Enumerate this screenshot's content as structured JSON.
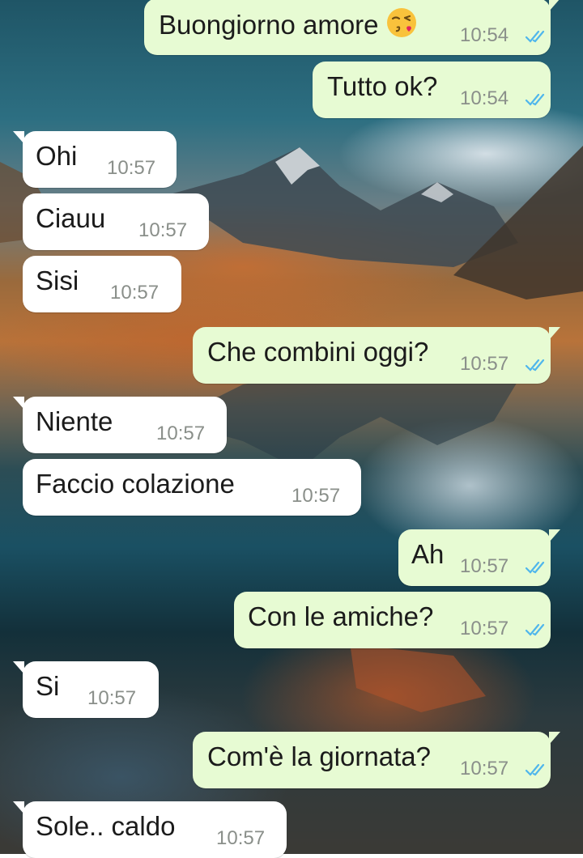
{
  "colors": {
    "outgoing_bubble": "#e7fbd3",
    "incoming_bubble": "#ffffff",
    "read_ticks": "#4fb6ec"
  },
  "icons": {
    "read_receipt": "double-check-icon",
    "emoji": "face-blowing-kiss-emoji"
  },
  "messages": [
    {
      "direction": "outgoing",
      "text": "Buongiorno amore",
      "time": "10:54",
      "status": "read"
    },
    {
      "direction": "outgoing",
      "text": "Tutto ok?",
      "time": "10:54",
      "status": "read"
    },
    {
      "direction": "incoming",
      "text": "Ohi",
      "time": "10:57"
    },
    {
      "direction": "incoming",
      "text": "Ciauu",
      "time": "10:57"
    },
    {
      "direction": "incoming",
      "text": "Sisi",
      "time": "10:57"
    },
    {
      "direction": "outgoing",
      "text": "Che combini oggi?",
      "time": "10:57",
      "status": "read"
    },
    {
      "direction": "incoming",
      "text": "Niente",
      "time": "10:57"
    },
    {
      "direction": "incoming",
      "text": "Faccio colazione",
      "time": "10:57"
    },
    {
      "direction": "outgoing",
      "text": "Ah",
      "time": "10:57",
      "status": "read"
    },
    {
      "direction": "outgoing",
      "text": "Con le amiche?",
      "time": "10:57",
      "status": "read"
    },
    {
      "direction": "incoming",
      "text": "Si",
      "time": "10:57"
    },
    {
      "direction": "outgoing",
      "text": "Com'è la giornata?",
      "time": "10:57",
      "status": "read"
    },
    {
      "direction": "incoming",
      "text": "Sole.. caldo",
      "time": "10:57"
    }
  ]
}
